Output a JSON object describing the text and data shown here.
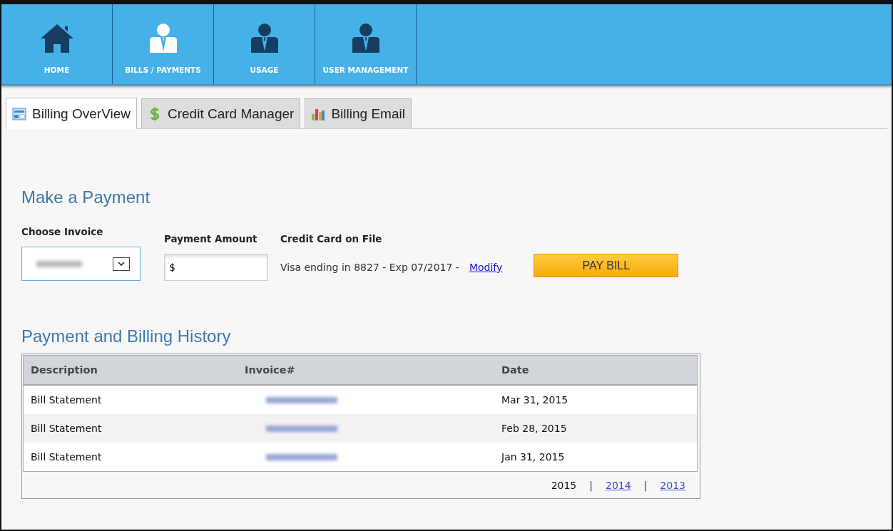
{
  "nav": [
    {
      "label": "HOME",
      "kind": "home",
      "selected": false
    },
    {
      "label": "BILLS / PAYMENTS",
      "kind": "person",
      "selected": true
    },
    {
      "label": "USAGE",
      "kind": "person",
      "selected": false
    },
    {
      "label": "USER MANAGEMENT",
      "kind": "person",
      "selected": false
    }
  ],
  "tabs": [
    {
      "label": "Billing OverView",
      "kind": "overview",
      "selected": true
    },
    {
      "label": "Credit Card Manager",
      "kind": "dollar",
      "selected": false
    },
    {
      "label": "Billing Email",
      "kind": "chart",
      "selected": false
    }
  ],
  "payment": {
    "title": "Make a Payment",
    "invoice_label": "Choose Invoice",
    "amount_label": "Payment Amount",
    "amount_value": "$",
    "card_label": "Credit Card on File",
    "card_text": "Visa ending in 8827 - Exp 07/2017 -",
    "modify_link": "Modify",
    "pay_button": "PAY BILL"
  },
  "history": {
    "title": "Payment and Billing History",
    "columns": [
      "Description",
      "Invoice#",
      "Date"
    ],
    "rows": [
      {
        "description": "Bill Statement",
        "date": "Mar 31, 2015"
      },
      {
        "description": "Bill Statement",
        "date": "Feb 28, 2015"
      },
      {
        "description": "Bill Statement",
        "date": "Jan 31, 2015"
      }
    ],
    "year_separator": "|",
    "years": [
      {
        "label": "2015",
        "selected": true
      },
      {
        "label": "2014",
        "selected": false
      },
      {
        "label": "2013",
        "selected": false
      }
    ]
  }
}
